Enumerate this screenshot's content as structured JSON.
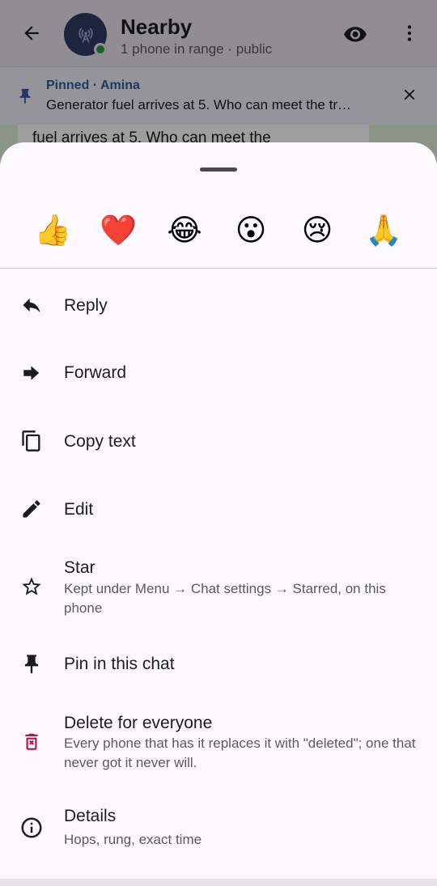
{
  "app_bar": {
    "title": "Nearby",
    "subtitle": "1 phone in range · public"
  },
  "pinned": {
    "label": "Pinned · Amina",
    "text": "Generator fuel arrives at 5. Who can meet the tr…"
  },
  "background_bubble": {
    "text": "fuel arrives at 5. Who can meet the"
  },
  "reactions": [
    "👍",
    "❤️",
    "😂",
    "😮",
    "😢",
    "🙏"
  ],
  "menu": {
    "reply": "Reply",
    "forward": "Forward",
    "copy": "Copy text",
    "edit": "Edit",
    "star": "Star",
    "star_sub": "Kept under Menu → Chat settings → Starred, on this phone",
    "pin": "Pin in this chat",
    "delete": "Delete for everyone",
    "delete_sub": "Every phone that has it replaces it with \"deleted\"; one that never got it never will.",
    "details": "Details",
    "details_sub": "Hops, rung, exact time"
  },
  "colors": {
    "danger": "#b3124e",
    "online": "#2e9a45",
    "pinned_accent": "#3d5a9a"
  }
}
